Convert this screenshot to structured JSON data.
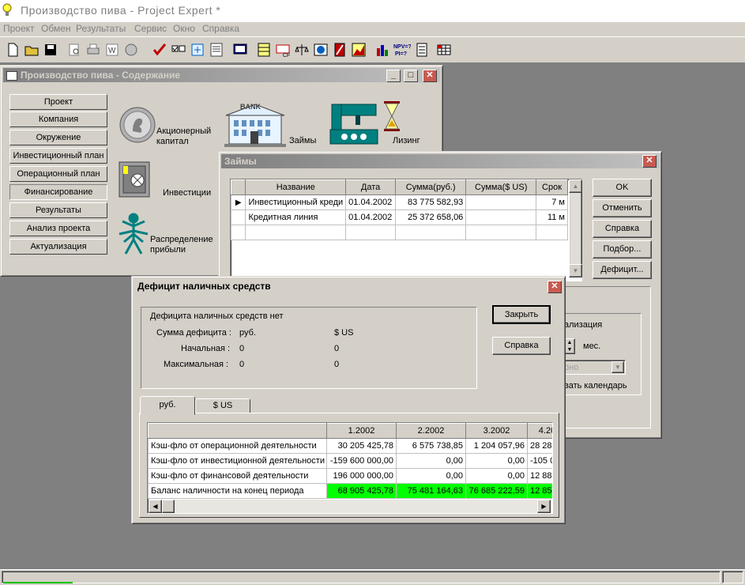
{
  "app": {
    "title": "Производство пива - Project Expert *"
  },
  "menu": [
    "Проект",
    "Обмен",
    "Результаты",
    "Сервис",
    "Окно",
    "Справка"
  ],
  "toolbar_icons": [
    "new-file-icon",
    "open-folder-icon",
    "save-icon",
    "print-preview-icon",
    "print-icon",
    "word-icon",
    "export-icon",
    "check-icon",
    "checklist-icon",
    "refresh-icon",
    "notes-icon",
    "monitor-icon",
    "table-icon",
    "chart-cf-icon",
    "scales-icon",
    "globe-icon",
    "book-icon",
    "area-chart-icon",
    "bar-chart-icon",
    "npv-pi-icon",
    "calculator-icon",
    "grid-icon"
  ],
  "content_window": {
    "title": "Производство пива - Содержание",
    "nav": [
      "Проект",
      "Компания",
      "Окружение",
      "Инвестиционный план",
      "Операционный план",
      "Финансирование",
      "Результаты",
      "Анализ проекта",
      "Актуализация"
    ],
    "selected": 5,
    "items": {
      "capital": "Акционерный\nкапитал",
      "bank_sign": "BANK",
      "loans": "Займы",
      "leasing": "Лизинг",
      "investments": "Инвестиции",
      "profit": "Распределение\nприбыли"
    }
  },
  "loans_window": {
    "title": "Займы",
    "columns": [
      "Название",
      "Дата",
      "Сумма(руб.)",
      "Сумма($ US)",
      "Срок"
    ],
    "rows": [
      [
        "Инвестиционный креди",
        "01.04.2002",
        "83 775 582,93",
        "",
        "7 м"
      ],
      [
        "Кредитная линия",
        "01.04.2002",
        "25 372 658,06",
        "",
        "11 м"
      ]
    ],
    "buttons": [
      "OK",
      "Отменить",
      "Справка",
      "Подбор...",
      "Дефицит..."
    ],
    "partial": {
      "actualization": "ализация",
      "months": "мес.",
      "combo": "оно",
      "calendar": "вать календарь"
    }
  },
  "deficit_window": {
    "title": "Дефицит наличных средств",
    "status": "Дефицита наличных средств нет",
    "sum_label": "Сумма дефицита :",
    "cur_rub": "руб.",
    "cur_usd": "$ US",
    "initial_label": "Начальная :",
    "initial_rub": "0",
    "initial_usd": "0",
    "max_label": "Максимальная :",
    "max_rub": "0",
    "max_usd": "0",
    "close_btn": "Закрыть",
    "help_btn": "Справка",
    "tabs": [
      "руб.",
      "$ US"
    ],
    "table": {
      "columns": [
        "",
        "1.2002",
        "2.2002",
        "3.2002",
        "4.20"
      ],
      "rows": [
        [
          "Кэш-фло от операционной деятельности",
          "30 205 425,78",
          "6 575 738,85",
          "1 204 057,96",
          "28 28"
        ],
        [
          "Кэш-фло от инвестиционной деятельности",
          "-159 600 000,00",
          "0,00",
          "0,00",
          "-105 00"
        ],
        [
          "Кэш-фло от финансовой деятельности",
          "196 000 000,00",
          "0,00",
          "0,00",
          "12 88"
        ],
        [
          "Баланс наличности на конец периода",
          "68 905 425,78",
          "75 481 164,63",
          "76 685 222,59",
          "12 85"
        ]
      ]
    }
  }
}
